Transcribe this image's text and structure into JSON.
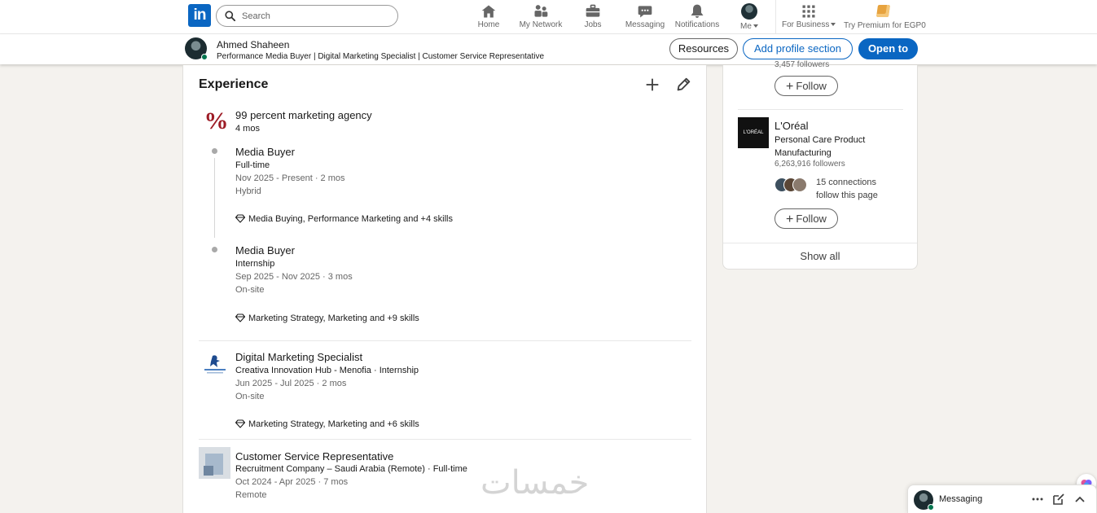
{
  "nav": {
    "logo_text": "in",
    "search_placeholder": "Search",
    "items": [
      {
        "label": "Home",
        "icon": "home-icon"
      },
      {
        "label": "My Network",
        "icon": "network-icon"
      },
      {
        "label": "Jobs",
        "icon": "briefcase-icon"
      },
      {
        "label": "Messaging",
        "icon": "chat-icon"
      },
      {
        "label": "Notifications",
        "icon": "bell-icon"
      },
      {
        "label": "Me",
        "icon": "avatar"
      }
    ],
    "business_label": "For Business",
    "premium_label": "Try Premium for EGP0"
  },
  "profile_bar": {
    "name": "Ahmed Shaheen",
    "headline": "Performance Media Buyer | Digital Marketing Specialist | Customer Service Representative",
    "resources_label": "Resources",
    "add_section_label": "Add profile section",
    "open_to_label": "Open to"
  },
  "experience": {
    "title": "Experience",
    "group": {
      "company": "99 percent marketing agency",
      "duration": "4 mos",
      "logo_text": "%",
      "roles": [
        {
          "title": "Media Buyer",
          "type": "Full-time",
          "dates": "Nov 2025 - Present · 2 mos",
          "location": "Hybrid",
          "skills": "Media Buying, Performance Marketing and +4 skills"
        },
        {
          "title": "Media Buyer",
          "type": "Internship",
          "dates": "Sep 2025 - Nov 2025 · 3 mos",
          "location": "On-site",
          "skills": "Marketing Strategy, Marketing and +9 skills"
        }
      ]
    },
    "entries": [
      {
        "title": "Digital Marketing Specialist",
        "company_line": "Creativa Innovation Hub - Menofia · Internship",
        "dates": "Jun 2025 - Jul 2025 · 2 mos",
        "location": "On-site",
        "skills": "Marketing Strategy, Marketing and +6 skills"
      },
      {
        "title": "Customer Service Representative",
        "company_line": "Recruitment Company – Saudi Arabia (Remote) · Full-time",
        "dates": "Oct 2024 - Apr 2025 · 7 mos",
        "location": "Remote"
      }
    ]
  },
  "sidebar": {
    "top_followers": "3,457 followers",
    "follow_label": "Follow",
    "company": {
      "logo_text": "L'ORÉAL",
      "name": "L'Oréal",
      "industry": "Personal Care Product Manufacturing",
      "followers": "6,263,916 followers",
      "connections": "15 connections follow this page"
    },
    "show_all_label": "Show all"
  },
  "watermark": "خمسات",
  "messaging": {
    "label": "Messaging"
  },
  "colors": {
    "brand": "#0a66c2",
    "page_bg": "#f4f2ee",
    "online": "#01754f"
  }
}
